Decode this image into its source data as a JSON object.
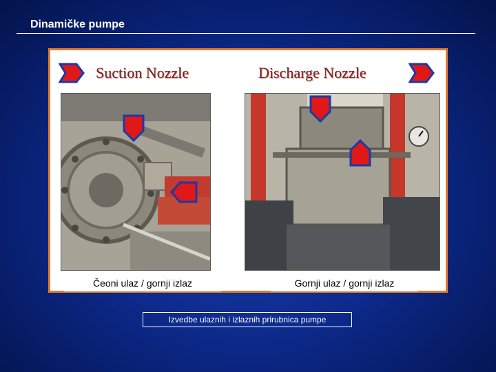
{
  "slide": {
    "title": "Dinamičke pumpe",
    "footer": "Izvedbe ulaznih i izlaznih prirubnica pumpe"
  },
  "figure": {
    "left_heading": "Suction Nozzle",
    "right_heading": "Discharge Nozzle",
    "left_caption": "Čeoni ulaz / gornji izlaz",
    "right_caption": "Gornji ulaz / gornji izlaz"
  },
  "colors": {
    "background": "#0d2a8c",
    "frame_border": "#e07a2b",
    "arrow_fill": "#e01818",
    "arrow_border": "#1a3aa8",
    "heading_text": "#7a1f1f"
  },
  "icons": [
    "arrow-right-icon",
    "arrow-down-icon",
    "arrow-up-icon",
    "arrow-left-icon"
  ]
}
